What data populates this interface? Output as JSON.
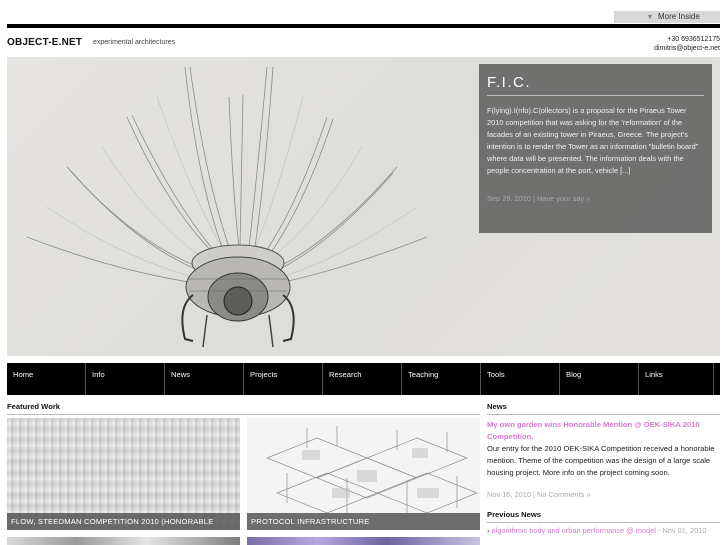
{
  "top": {
    "more_inside": "More Inside"
  },
  "header": {
    "site_title": "OBJECT-E.NET",
    "tagline": "experimental architectures",
    "phone": "+30 6936512175",
    "email": "dimitris@object-e.net"
  },
  "hero": {
    "title": "F.I.C.",
    "text": "F(lying).I(nfo).C(ollectors) is a proposal for the Piraeus Tower 2010 competition that was asking for the 'reformation' of the facades of an existing tower in Piraeus, Greece. The project's intention is to render the Tower as an information \"bulletin board\" where data will be presented. The information deals with the people concentration at the port, vehicle [...]",
    "meta": "Sep 29, 2010 | Have your say »"
  },
  "nav": {
    "items": [
      "Home",
      "Info",
      "News",
      "Projects",
      "Research",
      "Teaching",
      "Tools",
      "Blog",
      "Links"
    ]
  },
  "featured": {
    "heading": "Featured Work",
    "items": [
      {
        "caption": "FLOW, STEEDMAN COMPETITION 2010 (HONORABLE"
      },
      {
        "caption": "PROTOCOL INFRASTRUCTURE"
      }
    ]
  },
  "news": {
    "heading": "News",
    "title": "My own garden wins Honorable Mention @ OEK-SIKA 2010 Competition.",
    "body": "Our entry for the 2010 OEK-SIKA Competition received a honorable mention. Theme of the competition was the design of a large scale housing project. More info on the project coming soon.",
    "meta": "Nov 16, 2010 | No Comments »"
  },
  "previous_news": {
    "heading": "Previous News",
    "items": [
      {
        "bullet": "›",
        "link": "algorithmic body and urban performance @ model",
        "date": " - Nov 01, 2010"
      }
    ]
  },
  "colors": {
    "nav_bg": "#000000",
    "link_pink": "#d67ad0",
    "panel_grey": "#666666"
  }
}
